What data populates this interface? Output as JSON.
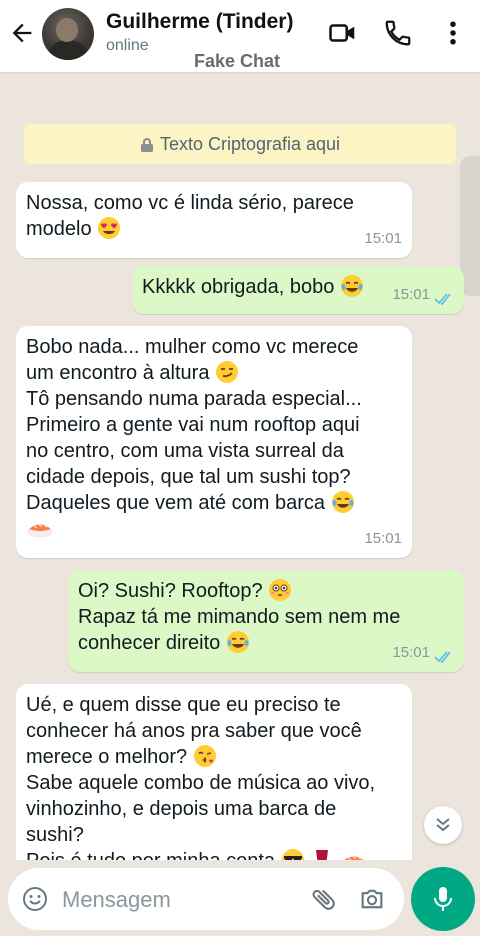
{
  "header": {
    "contact_name": "Guilherme (Tinder)",
    "status": "online",
    "overlay_label": "Fake Chat",
    "icons": [
      "back-arrow-icon",
      "video-call-icon",
      "phone-icon",
      "more-vert-icon"
    ]
  },
  "system_notice": {
    "text": "Texto Criptografia aqui",
    "icon": "lock-icon"
  },
  "messages": [
    {
      "direction": "in",
      "text": "Nossa, como vc é linda sério, parece\nmodelo",
      "emoji": [
        "heart-eyes"
      ],
      "time": "15:01"
    },
    {
      "direction": "out",
      "text": "Kkkkk obrigada, bobo",
      "emoji": [
        "tears-of-joy"
      ],
      "time": "15:01",
      "read": true
    },
    {
      "direction": "in",
      "text": "Bobo nada... mulher como vc merece\num encontro à altura",
      "emoji": [
        "smirk",
        "tears-of-joy",
        "sushi"
      ],
      "text2": "Tô pensando numa parada especial...\nPrimeiro a gente vai num rooftop aqui\nno centro, com uma vista surreal da\ncidade depois, que tal um sushi top?\nDaqueles que vem até com barca",
      "time": "15:01"
    },
    {
      "direction": "out",
      "text": "Oi? Sushi? Rooftop?",
      "emoji": [
        "flushed",
        "tears-of-joy"
      ],
      "text2": "Rapaz tá me mimando sem nem me\nconhecer direito",
      "time": "15:01",
      "read": true
    },
    {
      "direction": "in",
      "text": "Ué, e quem disse que eu preciso te\nconhecer há anos pra saber que você\nmerece o melhor?",
      "emoji": [
        "kiss",
        "sunglasses",
        "wine",
        "sushi"
      ],
      "text2": "Sabe aquele combo de música ao vivo,\nvinhozinho, e depois uma barca de\nsushi?",
      "text3": "Pois é tudo por minha conta"
    }
  ],
  "composer": {
    "placeholder": "Mensagem",
    "icons": [
      "emoji-icon",
      "attach-icon",
      "camera-icon",
      "mic-icon"
    ]
  },
  "colors": {
    "header_bg": "#ffffff",
    "chat_bg": "#ece5dd",
    "outgoing_bubble": "#dcf8c6",
    "incoming_bubble": "#ffffff",
    "accent": "#00a884",
    "read_ticks": "#53bdeb"
  }
}
